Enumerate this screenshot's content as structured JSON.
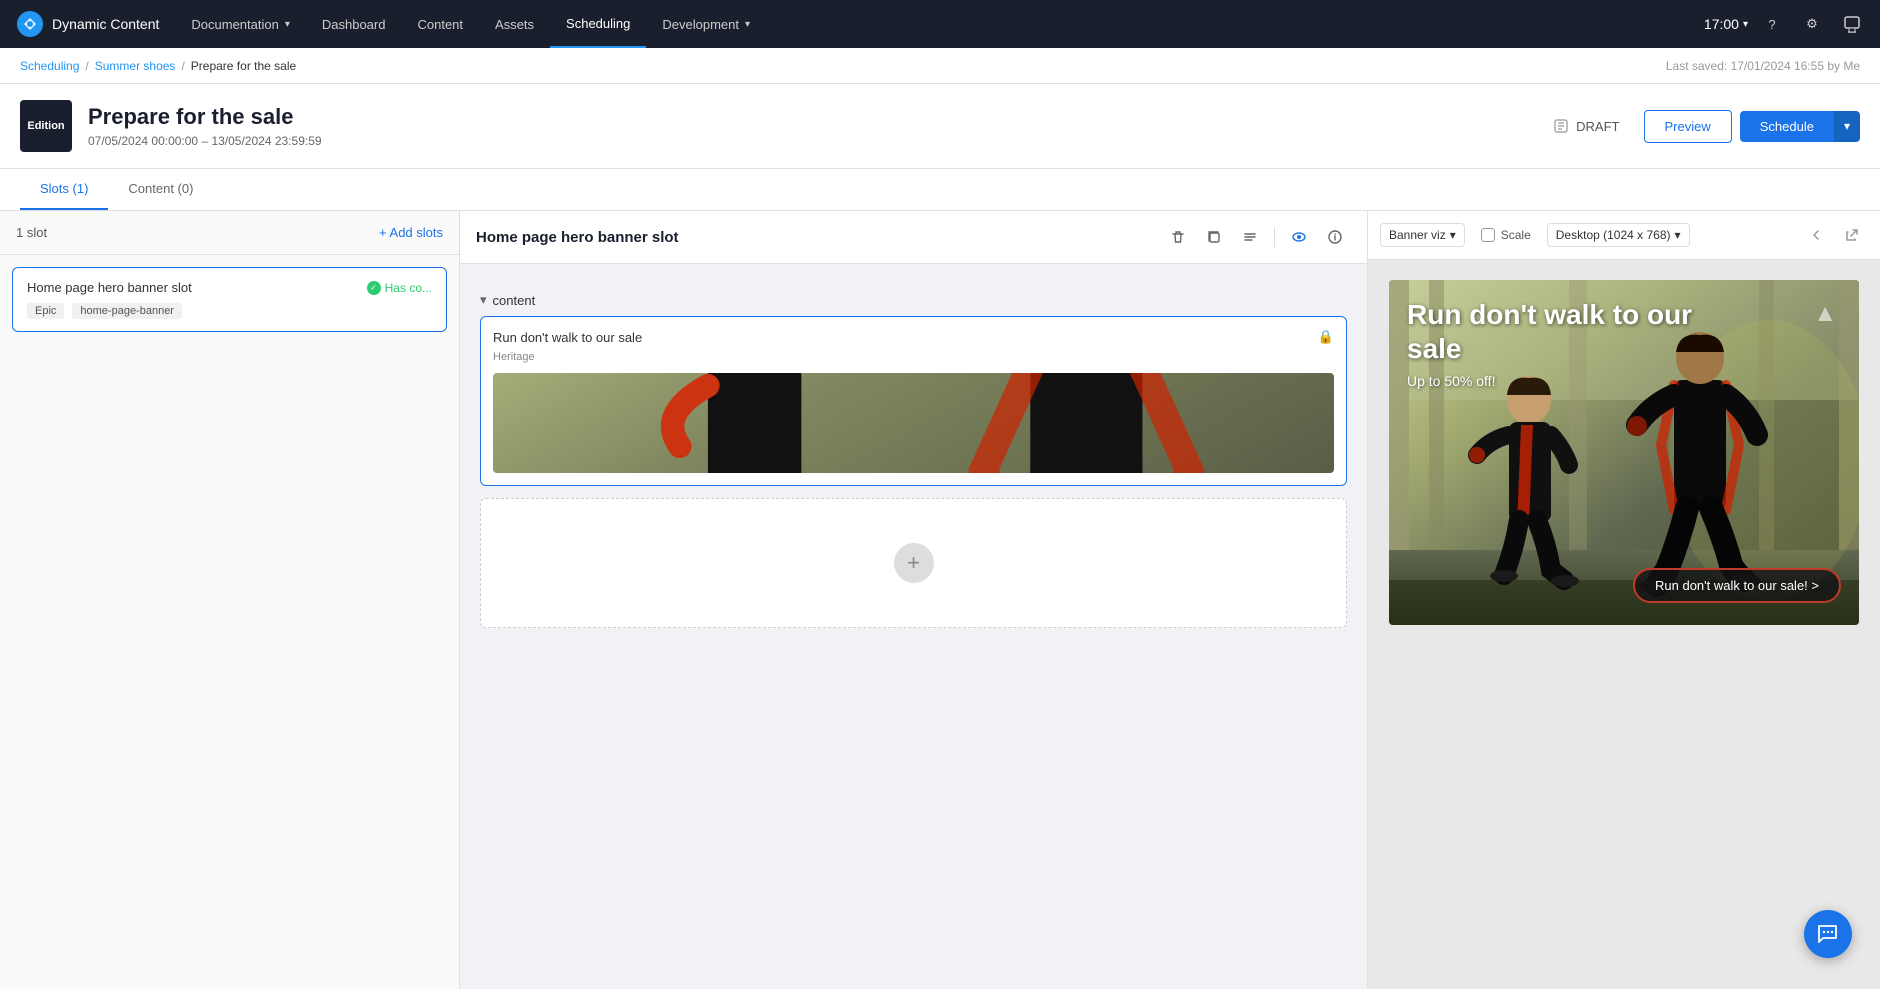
{
  "app": {
    "name": "Dynamic Content"
  },
  "nav": {
    "logo_text": "Edition",
    "items": [
      {
        "label": "Documentation",
        "has_arrow": true,
        "active": false
      },
      {
        "label": "Dashboard",
        "has_arrow": false,
        "active": false
      },
      {
        "label": "Content",
        "has_arrow": false,
        "active": false
      },
      {
        "label": "Assets",
        "has_arrow": false,
        "active": false
      },
      {
        "label": "Scheduling",
        "has_arrow": false,
        "active": true
      },
      {
        "label": "Development",
        "has_arrow": true,
        "active": false
      }
    ],
    "time": "17:00"
  },
  "breadcrumb": {
    "scheduling": "Scheduling",
    "summer_shoes": "Summer shoes",
    "current": "Prepare for the sale",
    "last_saved": "Last saved: 17/01/2024 16:55 by Me"
  },
  "page": {
    "title": "Prepare for the sale",
    "dates": "07/05/2024 00:00:00 – 13/05/2024 23:59:59",
    "edition_label": "Edition",
    "status": "DRAFT"
  },
  "buttons": {
    "draft": "DRAFT",
    "preview": "Preview",
    "schedule": "Schedule"
  },
  "tabs": [
    {
      "label": "Slots (1)",
      "active": true
    },
    {
      "label": "Content (0)",
      "active": false
    }
  ],
  "left_panel": {
    "slot_count": "1 slot",
    "add_slots_label": "+ Add slots",
    "slot_card": {
      "name": "Home page hero banner slot",
      "has_co_label": "Has co...",
      "tags": [
        "Epic",
        "home-page-banner"
      ]
    }
  },
  "center_panel": {
    "slot_title": "Home page hero banner slot",
    "section_label": "content",
    "content_card": {
      "title": "Run don't walk to our sale",
      "subtitle": "Heritage",
      "lock": true
    },
    "add_card_aria": "Add content"
  },
  "right_panel": {
    "viz_label": "Banner viz",
    "scale_label": "Scale",
    "desktop_label": "Desktop (1024 x 768)",
    "banner": {
      "title": "Run don't walk to our sale",
      "subtitle": "Up to 50% off!",
      "cta": "Run don't walk to our sale! >"
    }
  }
}
